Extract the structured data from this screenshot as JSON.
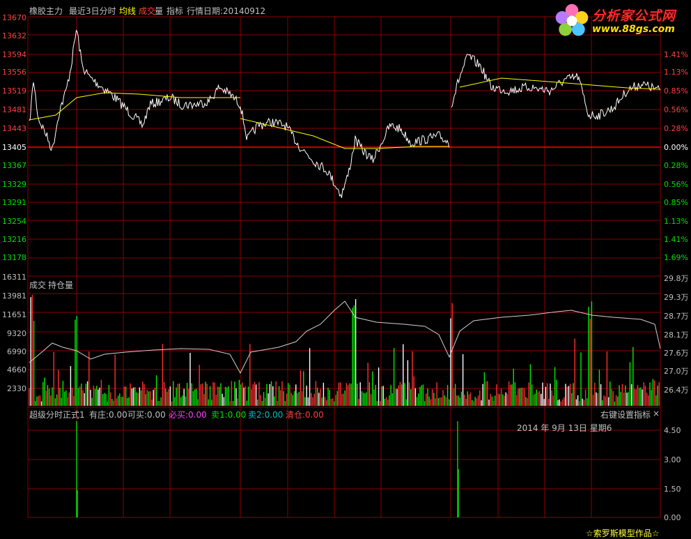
{
  "header": {
    "instrument": "橡胶主力",
    "period": "最近3日分时",
    "avg_line_label": "均线",
    "volume_label_a": "成交",
    "volume_label_b": "量",
    "indicator_label": "指标",
    "date_label": "行情日期:20140912"
  },
  "logo": {
    "title": "分析家公式网",
    "url": "www.88gs.com"
  },
  "price_axis": {
    "left": [
      "13670",
      "13632",
      "13594",
      "13556",
      "13519",
      "13481",
      "13443",
      "13405",
      "13367",
      "13329",
      "13291",
      "13254",
      "13216",
      "13178"
    ],
    "right": [
      "1.41%",
      "1.13%",
      "0.85%",
      "0.56%",
      "0.28%",
      "0.00%",
      "0.28%",
      "0.56%",
      "0.85%",
      "1.13%",
      "1.41%",
      "1.69%"
    ]
  },
  "volume_panel": {
    "title_a": "成交",
    "title_b": "持仓量",
    "left": [
      "16311",
      "13981",
      "11651",
      "9320",
      "6990",
      "4660",
      "2330"
    ],
    "right": [
      "29.8万",
      "29.3万",
      "28.7万",
      "28.1万",
      "27.6万",
      "27.0万",
      "26.4万"
    ]
  },
  "indicator_panel": {
    "name": "超级分时正式1",
    "items": [
      {
        "label": "有庄:",
        "value": "0.00"
      },
      {
        "label": "可买:",
        "value": "0.00"
      },
      {
        "label": "必买:",
        "value": "0.00"
      },
      {
        "label": "卖1:",
        "value": "0.00"
      },
      {
        "label": "卖2:",
        "value": "0.00"
      },
      {
        "label": "清仓:",
        "value": "0.00"
      }
    ],
    "settings_label": "右键设置指标",
    "close_label": "×",
    "date_display": "2014 年 9月 13日 星期6",
    "right_axis": [
      "4.50",
      "3.00",
      "1.50",
      "0.00"
    ],
    "footer": "☆索罗斯模型作品☆"
  },
  "colors": {
    "grid": "#8b0000",
    "price_line": "#ffffff",
    "avg_line": "#ffff00",
    "up": "#ff3030",
    "down": "#00ee00",
    "baseline": "#ff0000"
  }
}
